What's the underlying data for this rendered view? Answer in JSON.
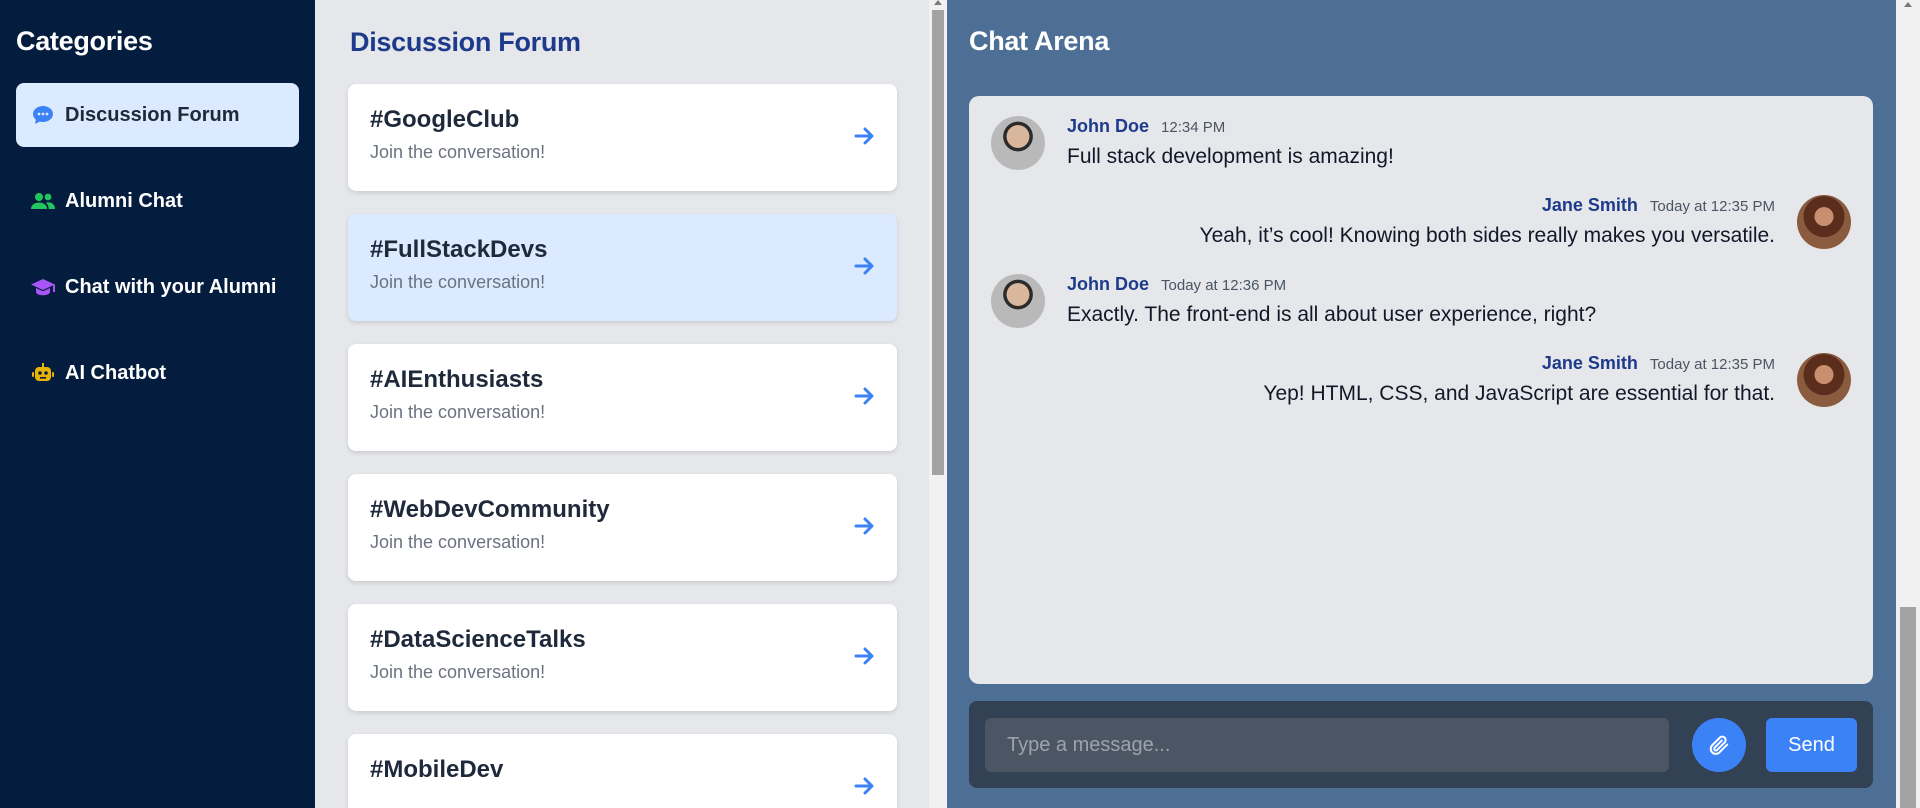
{
  "sidebar": {
    "title": "Categories",
    "items": [
      {
        "label": "Discussion Forum",
        "icon": "chat-bubble-icon",
        "color": "#3b82f6"
      },
      {
        "label": "Alumni Chat",
        "icon": "users-icon",
        "color": "#22c55e"
      },
      {
        "label": "Chat with your Alumni",
        "icon": "graduation-cap-icon",
        "color": "#a855f7"
      },
      {
        "label": "AI Chatbot",
        "icon": "robot-icon",
        "color": "#eab308"
      }
    ]
  },
  "forum": {
    "title": "Discussion Forum",
    "channels": [
      {
        "tag": "#GoogleClub",
        "sub": "Join the conversation!"
      },
      {
        "tag": "#FullStackDevs",
        "sub": "Join the conversation!"
      },
      {
        "tag": "#AIEnthusiasts",
        "sub": "Join the conversation!"
      },
      {
        "tag": "#WebDevCommunity",
        "sub": "Join the conversation!"
      },
      {
        "tag": "#DataScienceTalks",
        "sub": "Join the conversation!"
      },
      {
        "tag": "#MobileDev",
        "sub": ""
      }
    ]
  },
  "chat": {
    "title": "Chat Arena",
    "messages": [
      {
        "name": "John Doe",
        "time": "12:34 PM",
        "text": "Full stack development is amazing!"
      },
      {
        "name": "Jane Smith",
        "time": "Today at 12:35 PM",
        "text": "Yeah, it’s cool! Knowing both sides really makes you versatile."
      },
      {
        "name": "John Doe",
        "time": "Today at 12:36 PM",
        "text": "Exactly. The front-end is all about user experience, right?"
      },
      {
        "name": "Jane Smith",
        "time": "Today at 12:35 PM",
        "text": "Yep! HTML, CSS, and JavaScript are essential for that."
      }
    ],
    "input_placeholder": "Type a message...",
    "send_label": "Send"
  },
  "colors": {
    "accent": "#3b82f6",
    "sidebar_bg": "#041c3e",
    "chat_bg": "#4d6f95"
  }
}
